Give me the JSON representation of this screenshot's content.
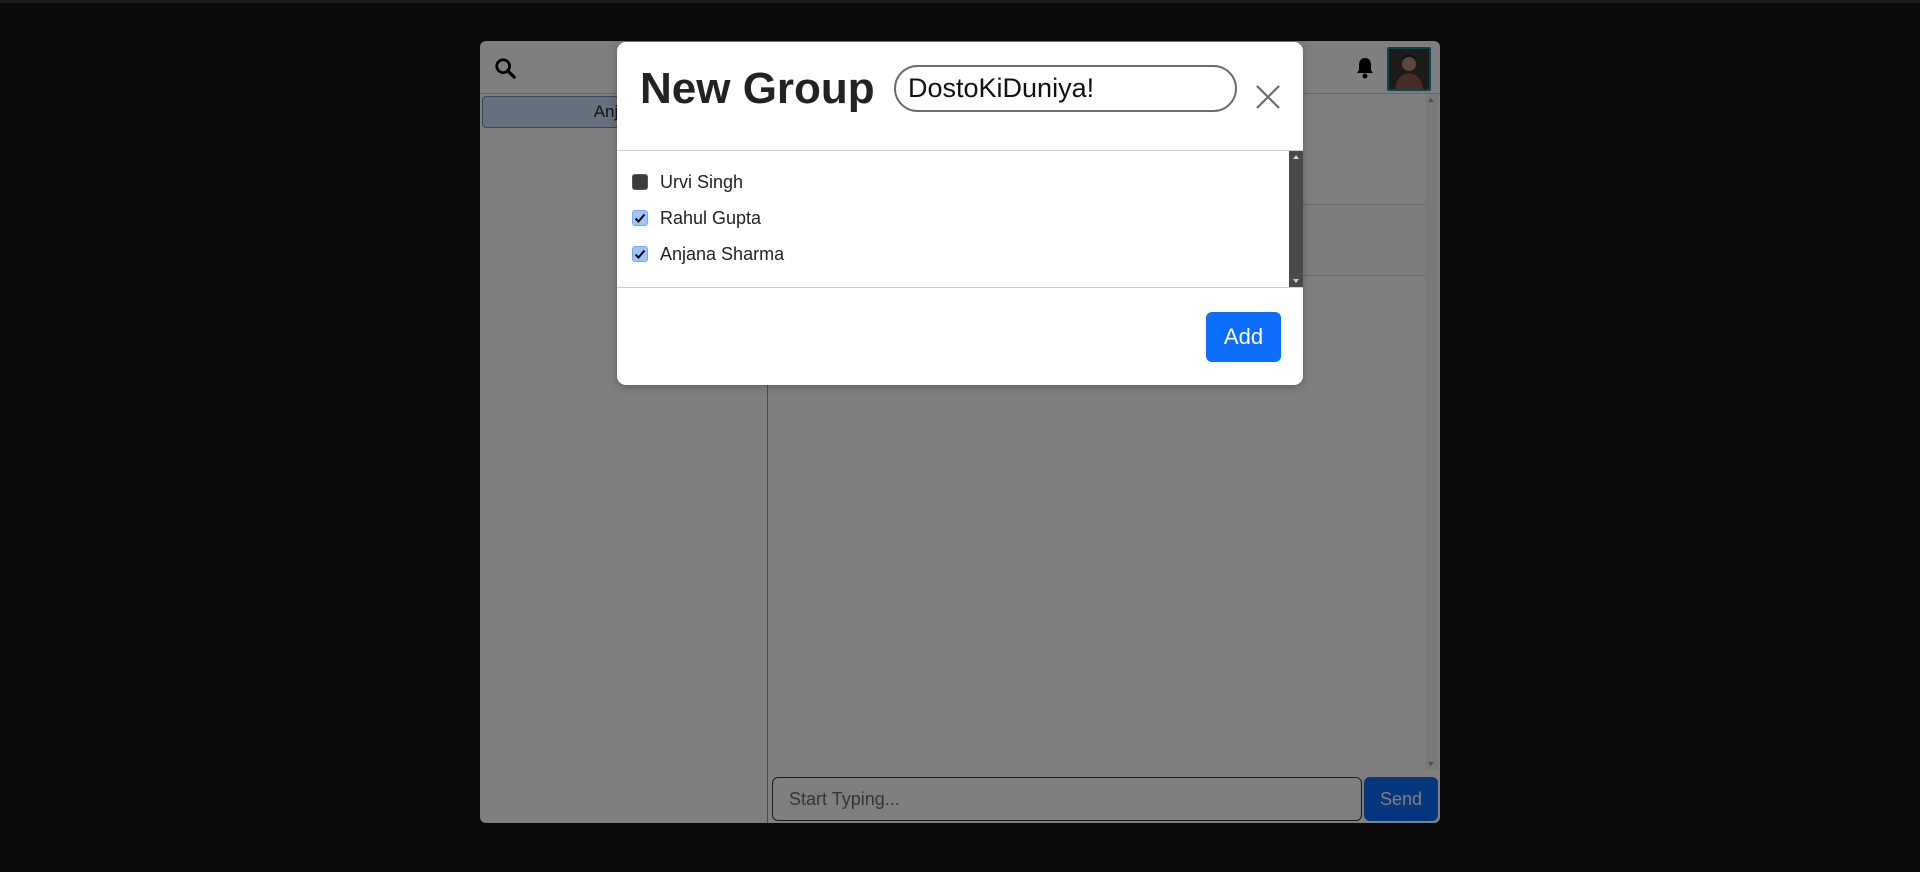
{
  "app": {
    "sidebar": {
      "chats": [
        {
          "label": "Anjalika"
        }
      ]
    },
    "composer": {
      "placeholder": "Start Typing...",
      "send_label": "Send"
    },
    "icons": {
      "search": "search-icon",
      "notifications": "bell-icon",
      "profile": "avatar"
    }
  },
  "modal": {
    "title": "New Group",
    "group_name_value": "DostoKiDuniya!",
    "close_icon": "close-icon",
    "members": [
      {
        "name": "Urvi Singh",
        "checked": false
      },
      {
        "name": "Rahul Gupta",
        "checked": true
      },
      {
        "name": "Anjana Sharma",
        "checked": true
      }
    ],
    "add_label": "Add"
  },
  "colors": {
    "primary": "#0d6efd",
    "checkbox_checked": "#9ec5fe",
    "backdrop": "#151515"
  }
}
